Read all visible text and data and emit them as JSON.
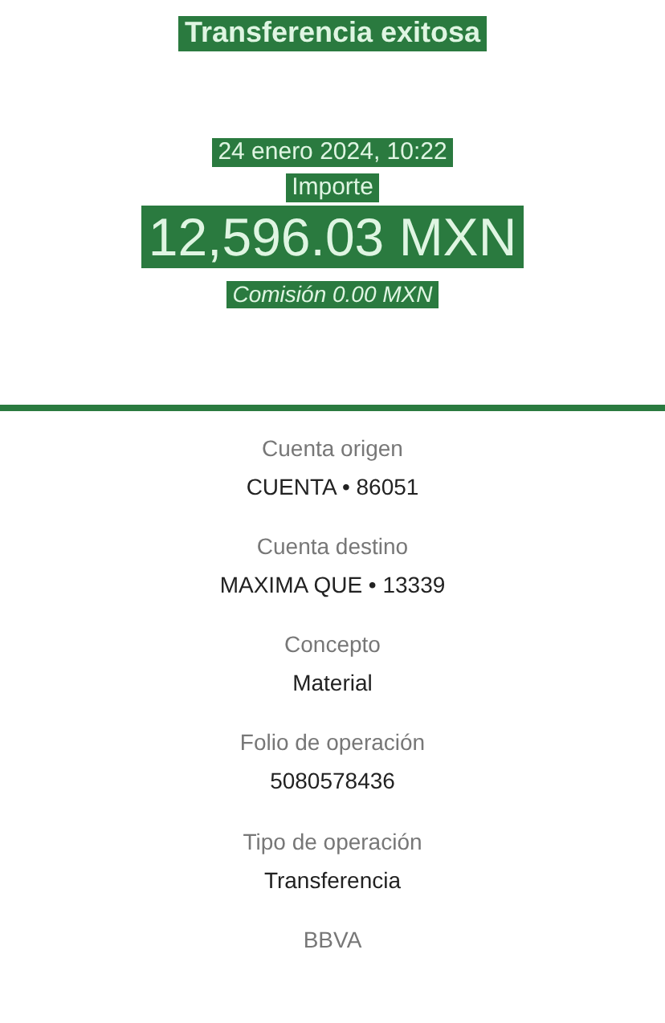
{
  "header": {
    "title": "Transferencia exitosa",
    "datetime": "24 enero 2024, 10:22",
    "amount_label": "Importe",
    "amount": "12,596.03 MXN",
    "fee": "Comisión 0.00 MXN"
  },
  "details": [
    {
      "label": "Cuenta origen",
      "value": "CUENTA • 86051"
    },
    {
      "label": "Cuenta destino",
      "value": "MAXIMA QUE • 13339"
    },
    {
      "label": "Concepto",
      "value": "Material"
    },
    {
      "label": "Folio de operación",
      "value": "5080578436"
    },
    {
      "label": "Tipo de operación",
      "value": "Transferencia"
    },
    {
      "label": "BBVA"
    }
  ]
}
